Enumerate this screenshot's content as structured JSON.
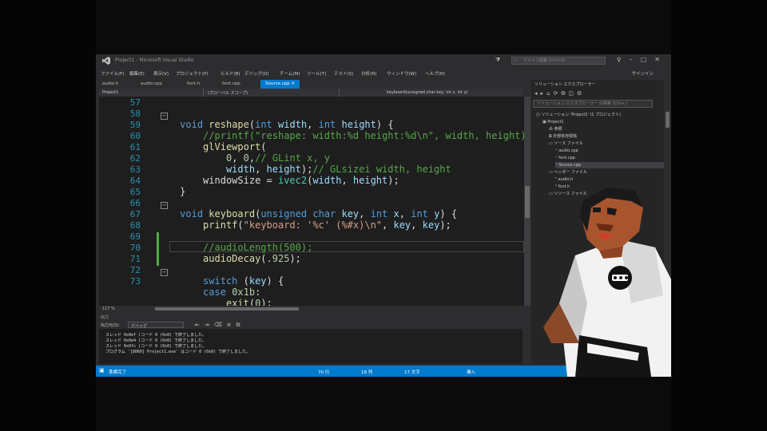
{
  "window": {
    "title": "Project1 - Microsoft Visual Studio",
    "quick_launch_placeholder": "クイック起動 (Ctrl+Q)",
    "sign_in": "サインイン"
  },
  "menu": [
    "ファイル(F)",
    "編集(E)",
    "表示(V)",
    "プロジェクト(P)",
    "ビルド(B)",
    "デバッグ(D)",
    "チーム(M)",
    "ツール(T)",
    "テスト(S)",
    "分析(N)",
    "ウィンドウ(W)",
    "ヘルプ(H)"
  ],
  "tabs": [
    {
      "label": "audio.h",
      "active": false
    },
    {
      "label": "audio.cpp",
      "active": false
    },
    {
      "label": "font.h",
      "active": false
    },
    {
      "label": "font.cpp",
      "active": false
    },
    {
      "label": "Source.cpp",
      "active": true
    }
  ],
  "navbar": {
    "project": "Project1",
    "scope": "(グローバル スコープ)",
    "member": "keyboard(unsigned char key, int x, int y)"
  },
  "editor": {
    "line_numbers": [
      "57",
      "58",
      "59",
      "60",
      "61",
      "62",
      "63",
      "64",
      "65",
      "66",
      "67",
      "68",
      "69",
      "70",
      "71",
      "72",
      "73"
    ],
    "zoom": "117 %"
  },
  "output": {
    "panel_title": "出力",
    "source_label": "出力元(S):",
    "source_value": "デバッグ",
    "lines": [
      "スレッド 0x0ef (コード 0 (0x0) で終了しました。",
      "スレッド 0x0e4 (コード 0 (0x0) で終了しました。",
      "スレッド 0x0fc (コード 0 (0x0) で終了しました。",
      "プログラム '[8060] Project1.exe' はコード 0 (0x0) で終了しました。"
    ]
  },
  "solution_explorer": {
    "title": "ソリューション エクスプローラー",
    "search_placeholder": "ソリューション エクスプローラー の検索 (Ctrl+;)",
    "items": [
      {
        "label": "ソリューション 'Project1' (1 プロジェクト)",
        "indent": 0,
        "icon": "solution-icon",
        "selected": false
      },
      {
        "label": "Project1",
        "indent": 1,
        "icon": "project-icon",
        "selected": false
      },
      {
        "label": "参照",
        "indent": 2,
        "icon": "references-icon",
        "selected": false
      },
      {
        "label": "外部依存関係",
        "indent": 2,
        "icon": "external-deps-icon",
        "selected": false
      },
      {
        "label": "ソース ファイル",
        "indent": 2,
        "icon": "folder-icon",
        "selected": false
      },
      {
        "label": "audio.cpp",
        "indent": 3,
        "icon": "cpp-file-icon",
        "selected": false
      },
      {
        "label": "font.cpp",
        "indent": 3,
        "icon": "cpp-file-icon",
        "selected": false
      },
      {
        "label": "Source.cpp",
        "indent": 3,
        "icon": "cpp-file-icon",
        "selected": true
      },
      {
        "label": "ヘッダー ファイル",
        "indent": 2,
        "icon": "folder-icon",
        "selected": false
      },
      {
        "label": "audio.h",
        "indent": 3,
        "icon": "header-file-icon",
        "selected": false
      },
      {
        "label": "font.h",
        "indent": 3,
        "icon": "header-file-icon",
        "selected": false
      },
      {
        "label": "リソース ファイル",
        "indent": 2,
        "icon": "folder-icon",
        "selected": false
      }
    ]
  },
  "status": {
    "ready": "準備完了",
    "line": "70 行",
    "col": "18 列",
    "ch": "17 文字",
    "ins": "挿入"
  },
  "colors": {
    "accent": "#007acc",
    "editor_bg": "#1e1e1e",
    "keyword": "#569cd6",
    "comment": "#57a64a",
    "string": "#d69d85"
  }
}
